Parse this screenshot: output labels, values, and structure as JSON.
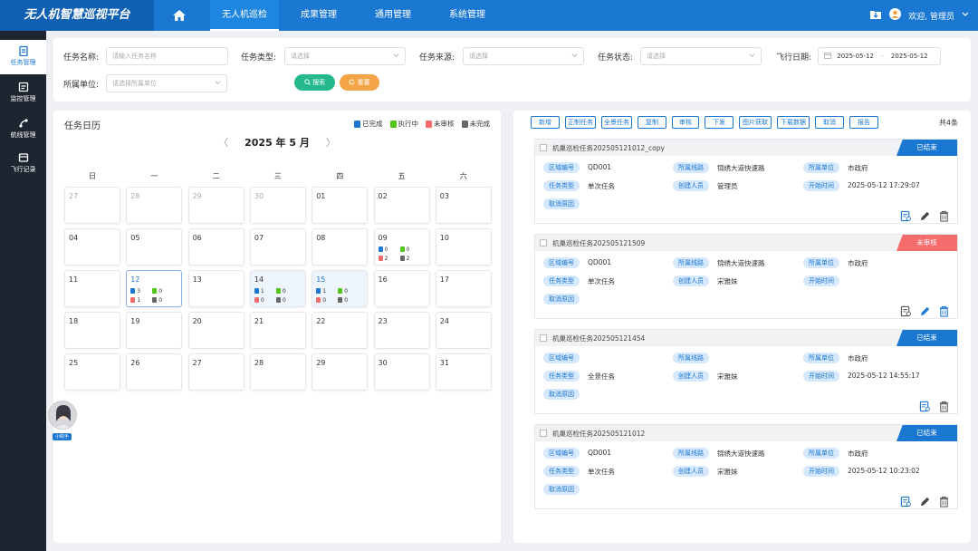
{
  "app_title": "无人机智慧巡视平台",
  "nav": {
    "tabs": [
      {
        "label": "无人机巡检",
        "active": true
      },
      {
        "label": "成果管理",
        "active": false
      },
      {
        "label": "通用管理",
        "active": false
      },
      {
        "label": "系统管理",
        "active": false
      }
    ],
    "user_greeting": "欢迎, 管理员"
  },
  "sidebar": {
    "items": [
      {
        "label": "任务管理",
        "icon": "task-icon",
        "active": true
      },
      {
        "label": "监控管理",
        "icon": "monitor-icon",
        "active": false
      },
      {
        "label": "航线管理",
        "icon": "route-icon",
        "active": false
      },
      {
        "label": "飞行记录",
        "icon": "flight-record-icon",
        "active": false
      }
    ]
  },
  "filters": {
    "task_name_label": "任务名称:",
    "task_name_placeholder": "请输入任务名称",
    "task_type_label": "任务类型:",
    "task_type_placeholder": "请选择",
    "task_source_label": "任务来源:",
    "task_source_placeholder": "请选择",
    "task_status_label": "任务状态:",
    "task_status_placeholder": "请选择",
    "flight_date_label": "飞行日期:",
    "date_start": "2025-05-12",
    "date_sep": "-",
    "date_end": "2025-05-12",
    "unit_label": "所属单位:",
    "unit_placeholder": "请选择所属单位",
    "search_button": "搜索",
    "reset_button": "重置"
  },
  "calendar": {
    "title": "任务日历",
    "legend": [
      {
        "label": "已完成",
        "color": "#1a77d2"
      },
      {
        "label": "执行中",
        "color": "#52c41a"
      },
      {
        "label": "未审核",
        "color": "#f56c6c"
      },
      {
        "label": "未完成",
        "color": "#666666"
      }
    ],
    "month_label": "2025 年 5 月",
    "prev": "〈",
    "next": "〉",
    "weekdays": [
      "日",
      "一",
      "二",
      "三",
      "四",
      "五",
      "六"
    ],
    "days": [
      {
        "n": "27",
        "other": true
      },
      {
        "n": "28",
        "other": true
      },
      {
        "n": "29",
        "other": true
      },
      {
        "n": "30",
        "other": true
      },
      {
        "n": "01"
      },
      {
        "n": "02"
      },
      {
        "n": "03"
      },
      {
        "n": "04"
      },
      {
        "n": "05"
      },
      {
        "n": "06"
      },
      {
        "n": "07"
      },
      {
        "n": "08"
      },
      {
        "n": "09",
        "counts": [
          "0",
          "0",
          "2",
          "2"
        ]
      },
      {
        "n": "10"
      },
      {
        "n": "11"
      },
      {
        "n": "12",
        "today": true,
        "counts": [
          "3",
          "0",
          "1",
          "0"
        ]
      },
      {
        "n": "13"
      },
      {
        "n": "14",
        "highlight": true,
        "counts": [
          "1",
          "0",
          "0",
          "0"
        ]
      },
      {
        "n": "15",
        "highlight": true,
        "today_text": true,
        "counts": [
          "1",
          "0",
          "0",
          "0"
        ]
      },
      {
        "n": "16"
      },
      {
        "n": "17"
      },
      {
        "n": "18"
      },
      {
        "n": "19"
      },
      {
        "n": "20"
      },
      {
        "n": "21"
      },
      {
        "n": "22"
      },
      {
        "n": "23"
      },
      {
        "n": "24"
      },
      {
        "n": "25"
      },
      {
        "n": "26"
      },
      {
        "n": "27"
      },
      {
        "n": "28"
      },
      {
        "n": "29"
      },
      {
        "n": "30"
      },
      {
        "n": "31"
      }
    ]
  },
  "toolbar": {
    "buttons": [
      "新增",
      "正制任务",
      "全景任务",
      "复制",
      "审核",
      "下发",
      "图片获取",
      "下载数据",
      "取消",
      "报告"
    ],
    "total": "共4条"
  },
  "field_labels": {
    "area": "区域编号",
    "route": "所属线路",
    "unit": "所属单位",
    "type": "任务类型",
    "creator": "创建人员",
    "start": "开始时间",
    "cancel_reason": "取消原因"
  },
  "tasks": [
    {
      "name": "机巢巡检任务202505121012_copy",
      "status": "已结束",
      "status_color": "#1a77d2",
      "area": "QD001",
      "route": "锦绣大道快速路",
      "unit": "市政府",
      "type": "单次任务",
      "creator": "管理员",
      "start": "2025-05-12 17:29:07"
    },
    {
      "name": "机巢巡检任务202505121509",
      "status": "未审核",
      "status_color": "#f56c6c",
      "area": "QD001",
      "route": "锦绣大道快速路",
      "unit": "市政府",
      "type": "单次任务",
      "creator": "宋雅妹",
      "start": ""
    },
    {
      "name": "机巢巡检任务202505121454",
      "status": "已结束",
      "status_color": "#1a77d2",
      "area": "",
      "route": "",
      "unit": "市政府",
      "type": "全景任务",
      "creator": "宋雅妹",
      "start": "2025-05-12 14:55:17"
    },
    {
      "name": "机巢巡检任务202505121012",
      "status": "已结束",
      "status_color": "#1a77d2",
      "area": "QD001",
      "route": "锦绣大道快速路",
      "unit": "市政府",
      "type": "单次任务",
      "creator": "宋雅妹",
      "start": "2025-05-12 10:23:02"
    }
  ],
  "avatar_label": "小助手"
}
